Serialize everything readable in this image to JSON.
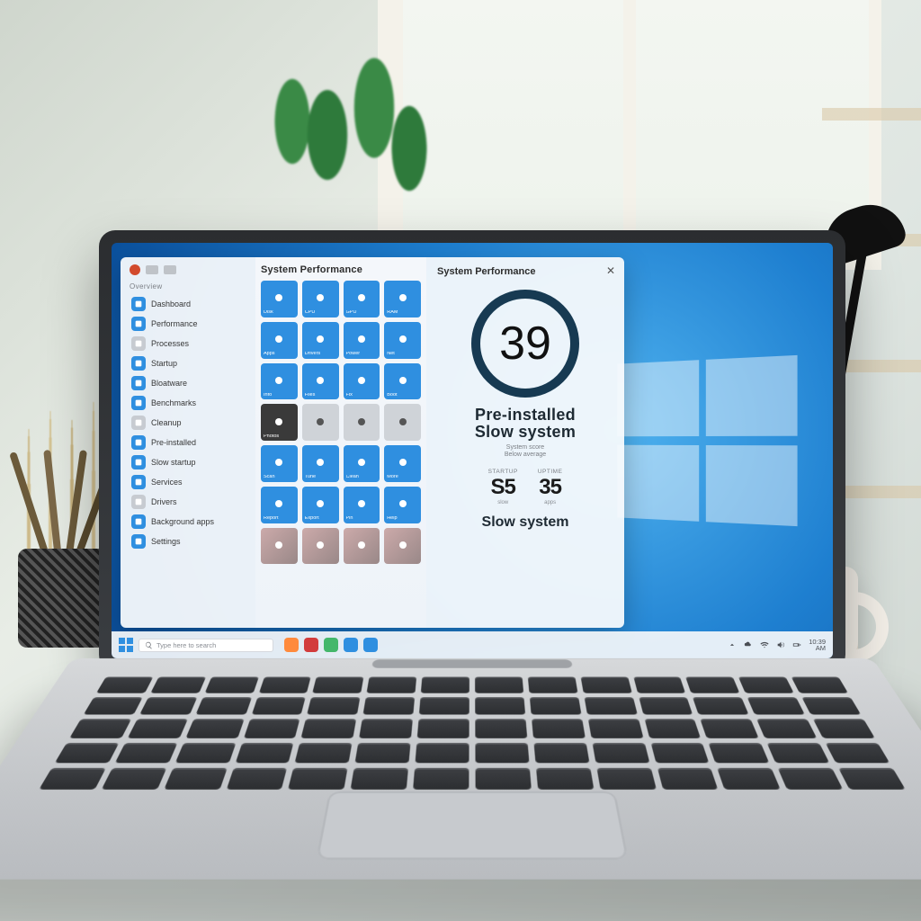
{
  "startmenu": {
    "section_header": "System Performance",
    "panel_header": "System Performance",
    "side": {
      "section_label": "Overview",
      "items": [
        {
          "label": "Dashboard"
        },
        {
          "label": "Performance"
        },
        {
          "label": "Processes"
        },
        {
          "label": "Startup"
        },
        {
          "label": "Bloatware"
        },
        {
          "label": "Benchmarks"
        },
        {
          "label": "Cleanup"
        },
        {
          "label": "Pre-installed"
        },
        {
          "label": "Slow startup"
        },
        {
          "label": "Services"
        },
        {
          "label": "Drivers"
        },
        {
          "label": "Background apps"
        },
        {
          "label": "Settings"
        }
      ]
    },
    "tiles": [
      {
        "label": "Disk"
      },
      {
        "label": "CPU"
      },
      {
        "label": "GPU"
      },
      {
        "label": "RAM"
      },
      {
        "label": "Apps"
      },
      {
        "label": "Drivers"
      },
      {
        "label": "Power"
      },
      {
        "label": "Net"
      },
      {
        "label": "Info"
      },
      {
        "label": "Files"
      },
      {
        "label": "Fix"
      },
      {
        "label": "Boot"
      },
      {
        "label": "Photos"
      },
      {
        "label": ""
      },
      {
        "label": ""
      },
      {
        "label": ""
      },
      {
        "label": "Scan"
      },
      {
        "label": "Tune"
      },
      {
        "label": "Clean"
      },
      {
        "label": "More"
      },
      {
        "label": "Report"
      },
      {
        "label": "Export"
      },
      {
        "label": "Pin"
      },
      {
        "label": "Help"
      },
      {
        "label": ""
      },
      {
        "label": ""
      },
      {
        "label": ""
      },
      {
        "label": ""
      }
    ],
    "panel": {
      "score": "39",
      "title_line1": "Pre-installed",
      "title_line2": "Slow system",
      "sub_line1": "System score",
      "sub_line2": "Below average",
      "stats": [
        {
          "header": "STARTUP",
          "value": "S5",
          "caption": "slow"
        },
        {
          "header": "UPTIME",
          "value": "35",
          "caption": "apps"
        }
      ],
      "footer": "Slow system"
    }
  },
  "taskbar": {
    "search_placeholder": "Type here to search",
    "time": "10:39",
    "date": "AM"
  },
  "colors": {
    "accent": "#2f8fe0"
  }
}
